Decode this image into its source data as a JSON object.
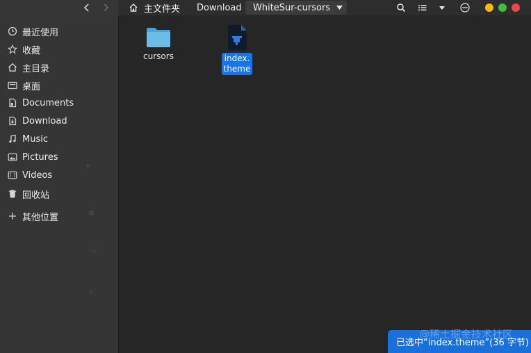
{
  "window": {
    "path": {
      "home": "主文件夹",
      "download": "Download",
      "current": "WhiteSur-cursors"
    },
    "colors": {
      "accent": "#1a74e8",
      "close": "#e9474c",
      "maximize": "#3fc03d",
      "minimize": "#f5b71f"
    }
  },
  "sidebar": {
    "items": [
      {
        "label": "最近使用",
        "icon": "clock-icon"
      },
      {
        "label": "收藏",
        "icon": "star-icon"
      },
      {
        "label": "主目录",
        "icon": "home-icon"
      },
      {
        "label": "桌面",
        "icon": "desktop-icon"
      },
      {
        "label": "Documents",
        "icon": "document-icon"
      },
      {
        "label": "Download",
        "icon": "download-icon"
      },
      {
        "label": "Music",
        "icon": "music-icon"
      },
      {
        "label": "Pictures",
        "icon": "picture-icon"
      },
      {
        "label": "Videos",
        "icon": "video-icon"
      },
      {
        "label": "回收站",
        "icon": "trash-icon"
      },
      {
        "label": "其他位置",
        "icon": "plus-icon"
      }
    ]
  },
  "files": [
    {
      "name": "cursors",
      "type": "folder",
      "selected": false
    },
    {
      "name_line1": "index.",
      "name_line2": "theme",
      "type": "theme-file",
      "selected": true
    }
  ],
  "status": {
    "text": "已选中“index.theme”(36 字节)"
  },
  "watermark": "@稀土掘金技术社区"
}
